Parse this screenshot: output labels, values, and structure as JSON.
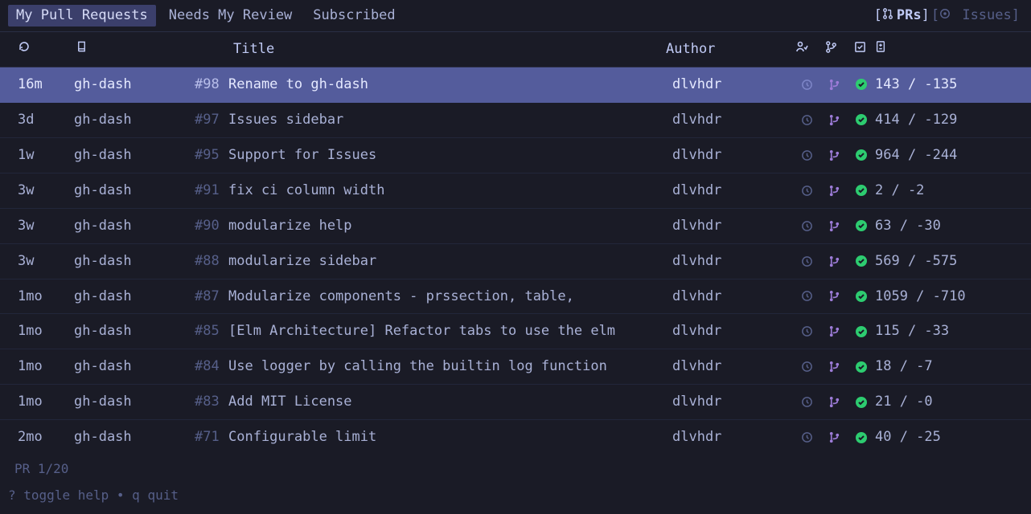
{
  "tabs": [
    {
      "label": "My Pull Requests",
      "active": true
    },
    {
      "label": "Needs My Review",
      "active": false
    },
    {
      "label": "Subscribed",
      "active": false
    }
  ],
  "view_switch": {
    "prs": {
      "label": "PRs",
      "active": true
    },
    "issues": {
      "label": "Issues",
      "active": false
    }
  },
  "columns": {
    "time_icon": "refresh-icon",
    "repo_icon": "repo-icon",
    "title": "Title",
    "author": "Author",
    "review_icon": "reviewer-icon",
    "branch_icon": "branch-icon",
    "ci_icon": "ci-icon",
    "diff_icon": "diff-icon"
  },
  "rows": [
    {
      "time": "16m",
      "repo": "gh-dash",
      "num": "#98",
      "title": "Rename to gh-dash",
      "author": "dlvhdr",
      "diff": "143 / -135",
      "selected": true
    },
    {
      "time": "3d",
      "repo": "gh-dash",
      "num": "#97",
      "title": "Issues sidebar",
      "author": "dlvhdr",
      "diff": "414 / -129"
    },
    {
      "time": "1w",
      "repo": "gh-dash",
      "num": "#95",
      "title": "Support for Issues",
      "author": "dlvhdr",
      "diff": "964 / -244"
    },
    {
      "time": "3w",
      "repo": "gh-dash",
      "num": "#91",
      "title": "fix ci column width",
      "author": "dlvhdr",
      "diff": "2 / -2"
    },
    {
      "time": "3w",
      "repo": "gh-dash",
      "num": "#90",
      "title": "modularize help",
      "author": "dlvhdr",
      "diff": "63 / -30"
    },
    {
      "time": "3w",
      "repo": "gh-dash",
      "num": "#88",
      "title": "modularize sidebar",
      "author": "dlvhdr",
      "diff": "569 / -575"
    },
    {
      "time": "1mo",
      "repo": "gh-dash",
      "num": "#87",
      "title": "Modularize components - prssection, table,",
      "author": "dlvhdr",
      "diff": "1059 / -710"
    },
    {
      "time": "1mo",
      "repo": "gh-dash",
      "num": "#85",
      "title": "[Elm Architecture] Refactor tabs to use the elm",
      "author": "dlvhdr",
      "diff": "115 / -33"
    },
    {
      "time": "1mo",
      "repo": "gh-dash",
      "num": "#84",
      "title": "Use logger by calling the builtin log function",
      "author": "dlvhdr",
      "diff": "18 / -7"
    },
    {
      "time": "1mo",
      "repo": "gh-dash",
      "num": "#83",
      "title": "Add MIT License",
      "author": "dlvhdr",
      "diff": "21 / -0"
    },
    {
      "time": "2mo",
      "repo": "gh-dash",
      "num": "#71",
      "title": "Configurable limit",
      "author": "dlvhdr",
      "diff": "40 / -25"
    }
  ],
  "pager": "PR 1/20",
  "help": {
    "toggle_key": "?",
    "toggle_label": "toggle help",
    "sep": "•",
    "quit_key": "q",
    "quit_label": "quit"
  }
}
